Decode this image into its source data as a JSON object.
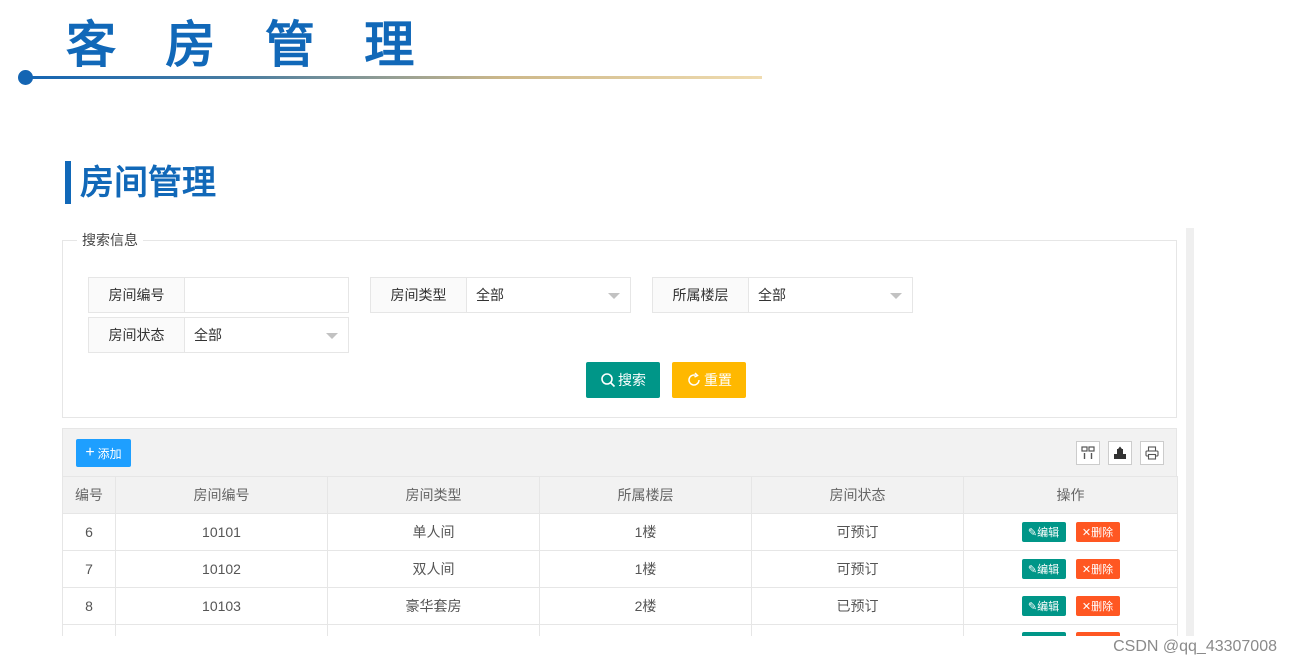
{
  "slide": {
    "title": "客 房 管 理",
    "section_title": "房间管理"
  },
  "search": {
    "legend": "搜索信息",
    "fields": [
      {
        "label": "房间编号",
        "value": ""
      },
      {
        "label": "房间类型",
        "value": "全部"
      },
      {
        "label": "所属楼层",
        "value": "全部"
      },
      {
        "label": "房间状态",
        "value": "全部"
      }
    ],
    "search_button": "搜索",
    "reset_button": "重置"
  },
  "toolbar": {
    "add_button": "添加",
    "icons": [
      "columns-icon",
      "export-icon",
      "print-icon"
    ]
  },
  "table": {
    "headers": [
      "编号",
      "房间编号",
      "房间类型",
      "所属楼层",
      "房间状态",
      "操作"
    ],
    "rows": [
      {
        "id": "6",
        "room_no": "10101",
        "type": "单人间",
        "floor": "1楼",
        "status": "可预订"
      },
      {
        "id": "7",
        "room_no": "10102",
        "type": "双人间",
        "floor": "1楼",
        "status": "可预订"
      },
      {
        "id": "8",
        "room_no": "10103",
        "type": "豪华套房",
        "floor": "2楼",
        "status": "已预订"
      },
      {
        "id": "",
        "room_no": "",
        "type": "",
        "floor": "",
        "status": ""
      }
    ],
    "edit_label": "编辑",
    "delete_label": "删除"
  },
  "watermark": "CSDN @qq_43307008",
  "colors": {
    "brand_blue": "#1168b8",
    "teal": "#009688",
    "amber": "#ffb800",
    "add_blue": "#1e9fff",
    "danger": "#ff5722"
  }
}
